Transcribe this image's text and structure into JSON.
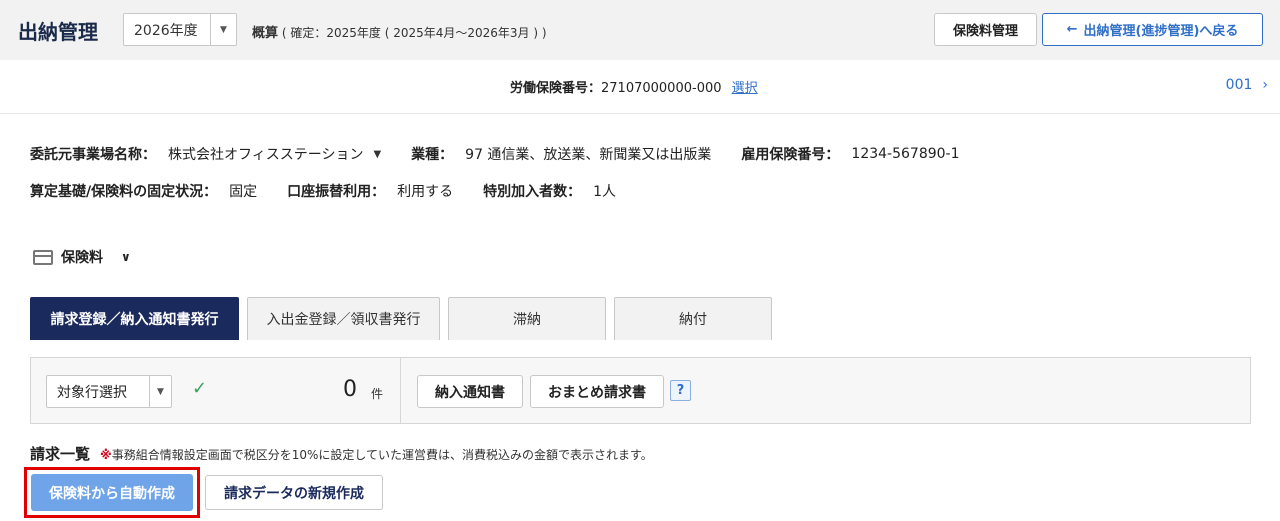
{
  "header": {
    "title": "出納管理",
    "year_value": "2026年度",
    "summary_label": "概算",
    "summary_detail": "( 確定：2025年度 ( 2025年4月～2026年3月 ) )",
    "insurance_button": "保険料管理",
    "back_button": "出納管理(進捗管理)へ戻る"
  },
  "numbar": {
    "label": "労働保険番号：",
    "value": "27107000000-000",
    "select_link": "選択",
    "page": "001"
  },
  "info": {
    "client_label": "委託元事業場名称：",
    "client_value": "株式会社オフィスステーション",
    "industry_label": "業種：",
    "industry_value": "97 通信業、放送業、新聞業又は出版業",
    "employment_label": "雇用保険番号：",
    "employment_value": "1234-567890-1",
    "fixed_label": "算定基礎/保険料の固定状況：",
    "fixed_value": "固定",
    "transfer_label": "口座振替利用：",
    "transfer_value": "利用する",
    "special_label": "特別加入者数：",
    "special_value": "1人"
  },
  "section": {
    "title": "保険料"
  },
  "tabs": [
    {
      "label": "請求登録／納入通知書発行"
    },
    {
      "label": "入出金登録／領収書発行"
    },
    {
      "label": "滞納"
    },
    {
      "label": "納付"
    }
  ],
  "toolbar": {
    "target_select": "対象行選択",
    "count": "0",
    "count_unit": "件",
    "notice_button": "納入通知書",
    "bundle_button": "おまとめ請求書",
    "help": "?"
  },
  "list": {
    "title": "請求一覧",
    "note_mark": "※",
    "note": "事務組合情報設定画面で税区分を10%に設定していた運営費は、消費税込みの金額で表示されます。",
    "auto_button": "保険料から自動作成",
    "new_button": "請求データの新規作成"
  },
  "colors": {
    "accent": "#2f6fc8",
    "tab_active": "#1b2a5c",
    "highlight": "#e10000",
    "auto_button": "#6fa4e8"
  }
}
